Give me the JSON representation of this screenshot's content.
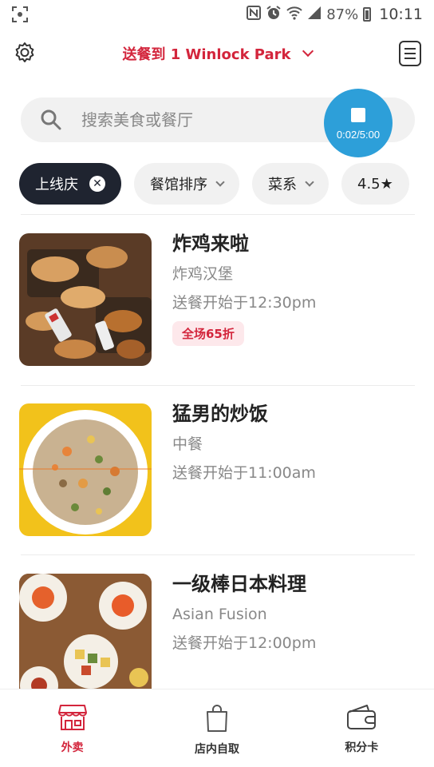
{
  "status_bar": {
    "battery": "87%",
    "time": "10:11"
  },
  "header": {
    "deliver_label": "送餐到 1 Winlock Park"
  },
  "search": {
    "placeholder": "搜索美食或餐厅"
  },
  "recording": {
    "time": "0:02/5:00"
  },
  "filters": [
    {
      "label": "上线庆",
      "active": true
    },
    {
      "label": "餐馆排序"
    },
    {
      "label": "菜系"
    },
    {
      "label": "4.5★"
    }
  ],
  "restaurants": [
    {
      "name": "炸鸡来啦",
      "cuisine": "炸鸡汉堡",
      "delivery": "送餐开始于12:30pm",
      "badge": "全场65折"
    },
    {
      "name": "猛男的炒饭",
      "cuisine": "中餐",
      "delivery": "送餐开始于11:00am"
    },
    {
      "name": "一级棒日本料理",
      "cuisine": "Asian Fusion",
      "delivery": "送餐开始于12:00pm"
    }
  ],
  "bottom_nav": [
    {
      "label": "外卖",
      "icon": "storefront-icon",
      "active": true
    },
    {
      "label": "店内自取",
      "icon": "shopping-bag-icon"
    },
    {
      "label": "积分卡",
      "icon": "wallet-icon"
    }
  ],
  "colors": {
    "brand": "#d3253c",
    "chip_active": "#1f2430",
    "record": "#2d9fd9"
  }
}
